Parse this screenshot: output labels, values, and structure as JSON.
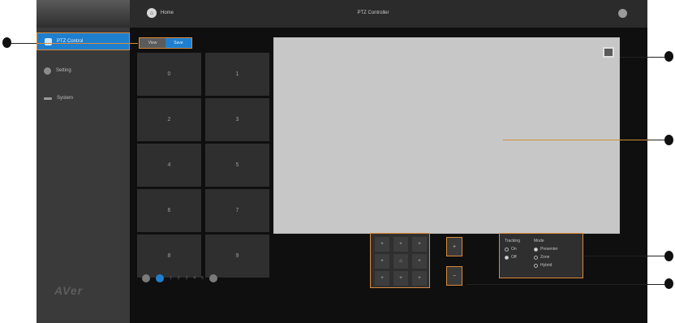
{
  "topbar": {
    "home_label": "Home",
    "title": "PTZ Controller"
  },
  "sidebar": {
    "items": [
      {
        "label": "PTZ Control",
        "icon": "camera-icon"
      },
      {
        "label": "Setting",
        "icon": "gear-icon"
      },
      {
        "label": "System",
        "icon": "system-icon"
      }
    ],
    "logo": "AVer"
  },
  "tabs": {
    "view": "View",
    "save": "Save"
  },
  "presets": [
    "0",
    "1",
    "2",
    "3",
    "4",
    "5",
    "6",
    "7",
    "8",
    "9"
  ],
  "pager": [
    "1",
    "2",
    "3",
    "4",
    "5"
  ],
  "keypad": {
    "up_left": "+",
    "up": "+",
    "up_right": "+",
    "left": "+",
    "home": "⌂",
    "right": "+",
    "down_left": "+",
    "down": "+",
    "down_right": "+",
    "zoom_in": "+",
    "zoom_out": "−"
  },
  "options": {
    "col1_title": "Tracking",
    "col1_opts": [
      "On",
      "Off"
    ],
    "col2_title": "Mode",
    "col2_opts": [
      "Presenter",
      "Zone",
      "Hybrid"
    ]
  },
  "colors": {
    "accent": "#1e7fcf",
    "highlight": "#d98a3a"
  }
}
